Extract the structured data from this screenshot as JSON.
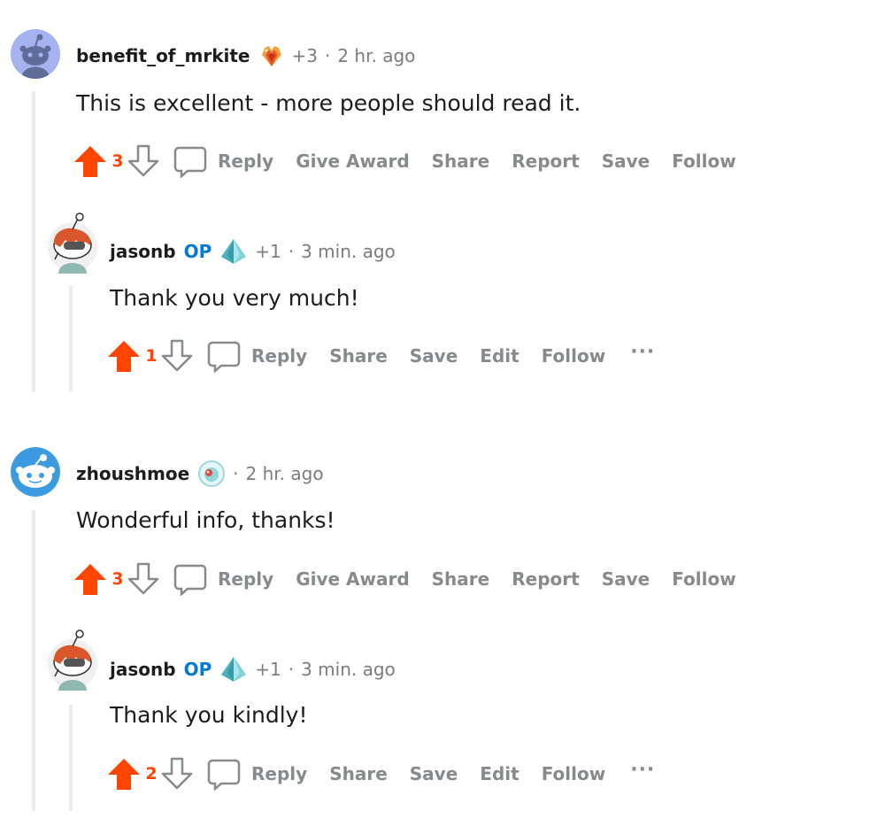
{
  "comments": [
    {
      "author": "benefit_of_mrkite",
      "karma": "+3",
      "separator": "·",
      "time": "2 hr. ago",
      "body": "This is excellent - more people should read it.",
      "score": "3",
      "actions": [
        "Reply",
        "Give Award",
        "Share",
        "Report",
        "Save",
        "Follow"
      ],
      "flair_icon": "heart-crystal-award-icon",
      "avatar_icon": "default-snoo-avatar",
      "reply": {
        "author": "jasonb",
        "op_label": "OP",
        "karma": "+1",
        "separator": "·",
        "time": "3 min. ago",
        "body": "Thank you very much!",
        "score": "1",
        "actions": [
          "Reply",
          "Share",
          "Save",
          "Edit",
          "Follow"
        ],
        "more": "···",
        "flair_icon": "diamond-award-icon",
        "avatar_icon": "custom-snoo-avatar"
      }
    },
    {
      "author": "zhoushmoe",
      "separator": "·",
      "time": "2 hr. ago",
      "body": "Wonderful info, thanks!",
      "score": "3",
      "actions": [
        "Reply",
        "Give Award",
        "Share",
        "Report",
        "Save",
        "Follow"
      ],
      "flair_icon": "eyeball-award-icon",
      "avatar_icon": "snoo-face-avatar",
      "reply": {
        "author": "jasonb",
        "op_label": "OP",
        "karma": "+1",
        "separator": "·",
        "time": "3 min. ago",
        "body": "Thank you kindly!",
        "score": "2",
        "actions": [
          "Reply",
          "Share",
          "Save",
          "Edit",
          "Follow"
        ],
        "more": "···",
        "flair_icon": "diamond-award-icon",
        "avatar_icon": "custom-snoo-avatar"
      }
    }
  ],
  "colors": {
    "upvote": "#ff4500",
    "op": "#0079d3",
    "muted": "#878a8c",
    "thread_line": "#ececec"
  }
}
